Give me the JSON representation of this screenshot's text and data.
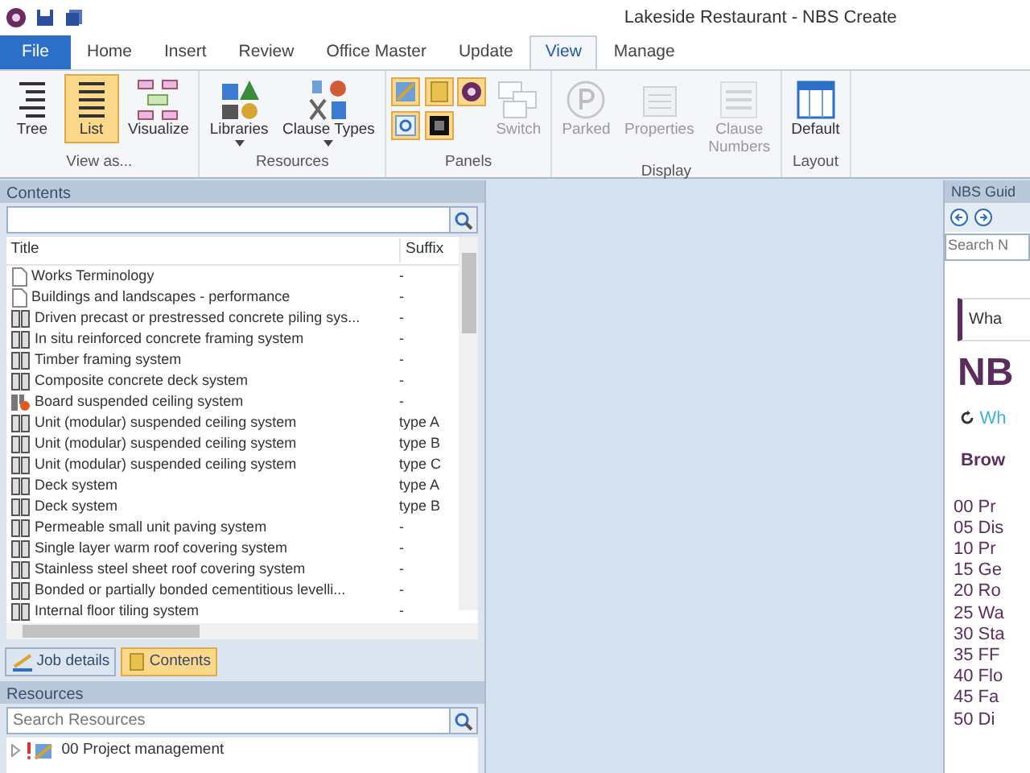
{
  "window": {
    "title": "Lakeside Restaurant  - NBS Create"
  },
  "ribbon_tabs": [
    {
      "label": "File",
      "kind": "file",
      "selected": false
    },
    {
      "label": "Home",
      "kind": "tab",
      "selected": false
    },
    {
      "label": "Insert",
      "kind": "tab",
      "selected": false
    },
    {
      "label": "Review",
      "kind": "tab",
      "selected": false
    },
    {
      "label": "Office Master",
      "kind": "tab",
      "selected": false
    },
    {
      "label": "Update",
      "kind": "tab",
      "selected": false
    },
    {
      "label": "View",
      "kind": "tab",
      "selected": true
    },
    {
      "label": "Manage",
      "kind": "tab",
      "selected": false
    }
  ],
  "ribbon_groups": [
    {
      "label": "View as...",
      "buttons": [
        {
          "kind": "large",
          "label": "Tree",
          "selected": false,
          "disabled": false
        },
        {
          "kind": "large",
          "label": "List",
          "selected": true,
          "disabled": false
        },
        {
          "kind": "large",
          "label": "Visualize",
          "selected": false,
          "disabled": false
        }
      ]
    },
    {
      "label": "Resources",
      "buttons": [
        {
          "kind": "dropdown",
          "label": "Libraries",
          "selected": false,
          "disabled": false
        },
        {
          "kind": "dropdown",
          "label": "Clause Types",
          "selected": false,
          "disabled": false
        }
      ]
    },
    {
      "label": "Panels",
      "buttons": [
        {
          "kind": "small",
          "selected": true,
          "disabled": false
        },
        {
          "kind": "small",
          "selected": true,
          "disabled": false
        },
        {
          "kind": "small",
          "selected": true,
          "disabled": false
        },
        {
          "kind": "small",
          "selected": true,
          "disabled": false
        },
        {
          "kind": "small",
          "selected": true,
          "disabled": false
        },
        {
          "kind": "large",
          "label": "Switch",
          "selected": false,
          "disabled": true
        }
      ]
    },
    {
      "label": "Display",
      "buttons": [
        {
          "kind": "large",
          "label": "Parked",
          "selected": false,
          "disabled": true
        },
        {
          "kind": "large",
          "label": "Properties",
          "selected": false,
          "disabled": true
        },
        {
          "kind": "large",
          "label": "Clause Numbers",
          "selected": false,
          "disabled": true
        }
      ]
    },
    {
      "label": "Layout",
      "buttons": [
        {
          "kind": "large",
          "label": "Default",
          "selected": false,
          "disabled": false
        }
      ]
    }
  ],
  "contents": {
    "title": "Contents",
    "columns": [
      "Title",
      "Suffix"
    ],
    "rows": [
      {
        "kind": "document",
        "title": "Works Terminology",
        "suffix": "-"
      },
      {
        "kind": "document",
        "title": "Buildings and landscapes - performance",
        "suffix": "-"
      },
      {
        "kind": "system",
        "title": "Driven precast or prestressed concrete piling sys...",
        "suffix": "-"
      },
      {
        "kind": "system",
        "title": "In situ reinforced concrete framing system",
        "suffix": "-"
      },
      {
        "kind": "system",
        "title": "Timber framing system",
        "suffix": "-"
      },
      {
        "kind": "system",
        "title": "Composite concrete deck system",
        "suffix": "-"
      },
      {
        "kind": "flagged",
        "title": "Board suspended ceiling system",
        "suffix": "-"
      },
      {
        "kind": "system",
        "title": "Unit (modular) suspended ceiling system",
        "suffix": "type A"
      },
      {
        "kind": "system",
        "title": "Unit (modular) suspended ceiling system",
        "suffix": "type B"
      },
      {
        "kind": "system",
        "title": "Unit (modular) suspended ceiling system",
        "suffix": "type C"
      },
      {
        "kind": "system",
        "title": "Deck system",
        "suffix": "type A"
      },
      {
        "kind": "system",
        "title": "Deck system",
        "suffix": "type B"
      },
      {
        "kind": "system",
        "title": "Permeable small unit paving system",
        "suffix": "-"
      },
      {
        "kind": "system",
        "title": "Single layer warm roof covering system",
        "suffix": "-"
      },
      {
        "kind": "system",
        "title": "Stainless steel sheet roof covering system",
        "suffix": "-"
      },
      {
        "kind": "system",
        "title": "Bonded or partially bonded cementitious levelli...",
        "suffix": "-"
      },
      {
        "kind": "system",
        "title": "Internal floor tiling system",
        "suffix": "-"
      }
    ]
  },
  "panel_tabs": [
    {
      "label": "Job details",
      "selected": false
    },
    {
      "label": "Contents",
      "selected": true
    }
  ],
  "resources": {
    "title": "Resources",
    "search": {
      "placeholder": "Search Resources"
    },
    "tree": [
      {
        "label": "00 Project management",
        "expanded": false
      }
    ]
  },
  "guide": {
    "title": "NBS Guid",
    "search": {
      "placeholder": "Search N"
    },
    "callout": "Wha",
    "heading": "NB",
    "link": "Wh",
    "subheading": "Brow",
    "items": [
      "00 Pr",
      "05 Dis",
      "10 Pr",
      "15 Ge",
      "20 Ro",
      "25 Wa",
      "30 Sta",
      "35 FF",
      "40 Flo",
      "45 Fa",
      "50 Di"
    ]
  }
}
